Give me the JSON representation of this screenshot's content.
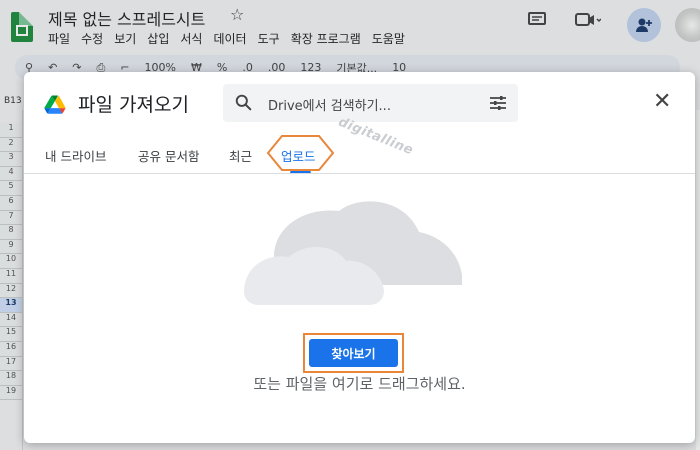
{
  "sheet": {
    "title": "제목 없는 스프레드시트",
    "menus": [
      "파일",
      "수정",
      "보기",
      "삽입",
      "서식",
      "데이터",
      "도구",
      "확장 프로그램",
      "도움말"
    ],
    "toolbar": {
      "zoom": "100%",
      "font": "기본값...",
      "font_size": "10",
      "currency": "₩",
      "percent": "%",
      "decimals_decrease": ".0",
      "decimals_increase": ".00",
      "number_format": "123"
    },
    "cell_ref": "B13",
    "rows": [
      "1",
      "2",
      "3",
      "4",
      "5",
      "6",
      "7",
      "8",
      "9",
      "10",
      "11",
      "12",
      "13",
      "14",
      "15",
      "16",
      "17",
      "18",
      "19"
    ],
    "active_row": "13"
  },
  "dialog": {
    "title": "파일 가져오기",
    "search_placeholder": "Drive에서 검색하기...",
    "tabs": [
      {
        "label": "내 드라이브",
        "active": false
      },
      {
        "label": "공유 문서함",
        "active": false
      },
      {
        "label": "최근",
        "active": false
      },
      {
        "label": "업로드",
        "active": true
      }
    ],
    "browse_label": "찾아보기",
    "drop_hint": "또는 파일을 여기로 드래그하세요.",
    "watermark": "digitalline"
  },
  "colors": {
    "accent": "#1a73e8",
    "highlight": "#e8863a",
    "sheets_green": "#1e8e3e"
  },
  "icons": {
    "drive": "google-drive-icon",
    "search": "search-icon",
    "filter": "filter-sliders-icon",
    "close": "close-icon",
    "cloud": "cloud-illustration"
  }
}
